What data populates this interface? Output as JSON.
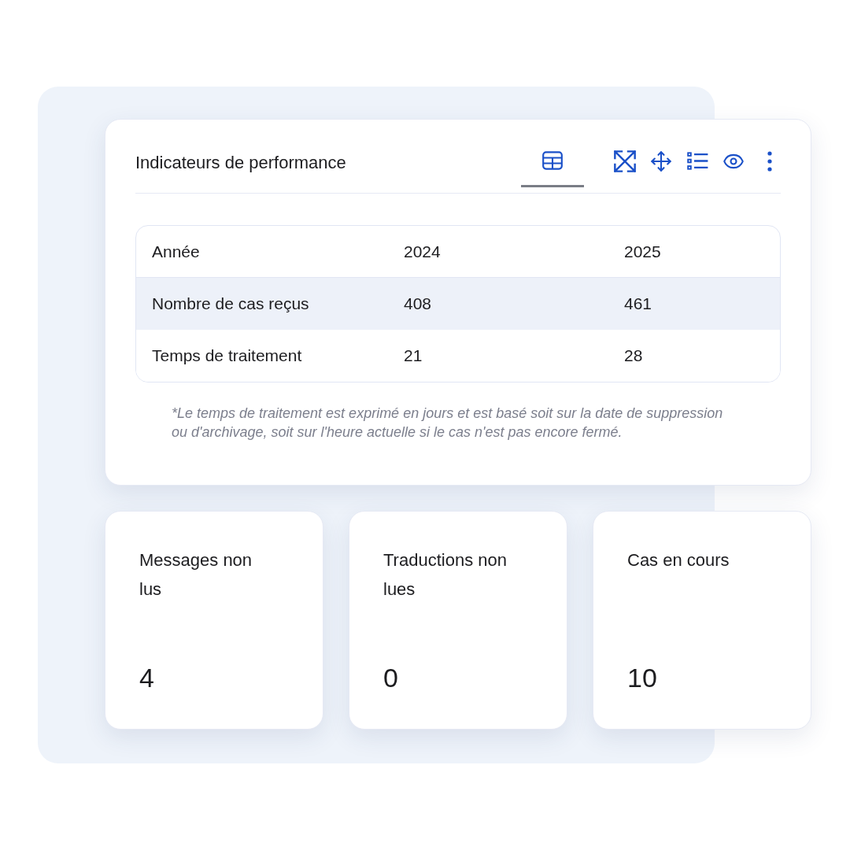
{
  "performance_card": {
    "title": "Indicateurs de performance",
    "view_tabs": [
      {
        "kind": "table",
        "selected": true
      }
    ],
    "table": {
      "columns": [
        "Année",
        "2024",
        "2025"
      ],
      "rows": [
        {
          "cells": [
            "Nombre de cas reçus",
            "408",
            "461"
          ],
          "highlighted": true
        },
        {
          "cells": [
            "Temps de traitement",
            "21",
            "28"
          ],
          "highlighted": false
        }
      ]
    },
    "footnote": "*Le temps de traitement est exprimé en jours et est basé soit sur la date de suppression ou d'archivage, soit sur l'heure actuelle si le cas n'est pas encore fermé."
  },
  "stat_cards": [
    {
      "label": "Messages non lus",
      "value": "4"
    },
    {
      "label": "Traductions non lues",
      "value": "0"
    },
    {
      "label": "Cas en cours",
      "value": "10"
    }
  ]
}
